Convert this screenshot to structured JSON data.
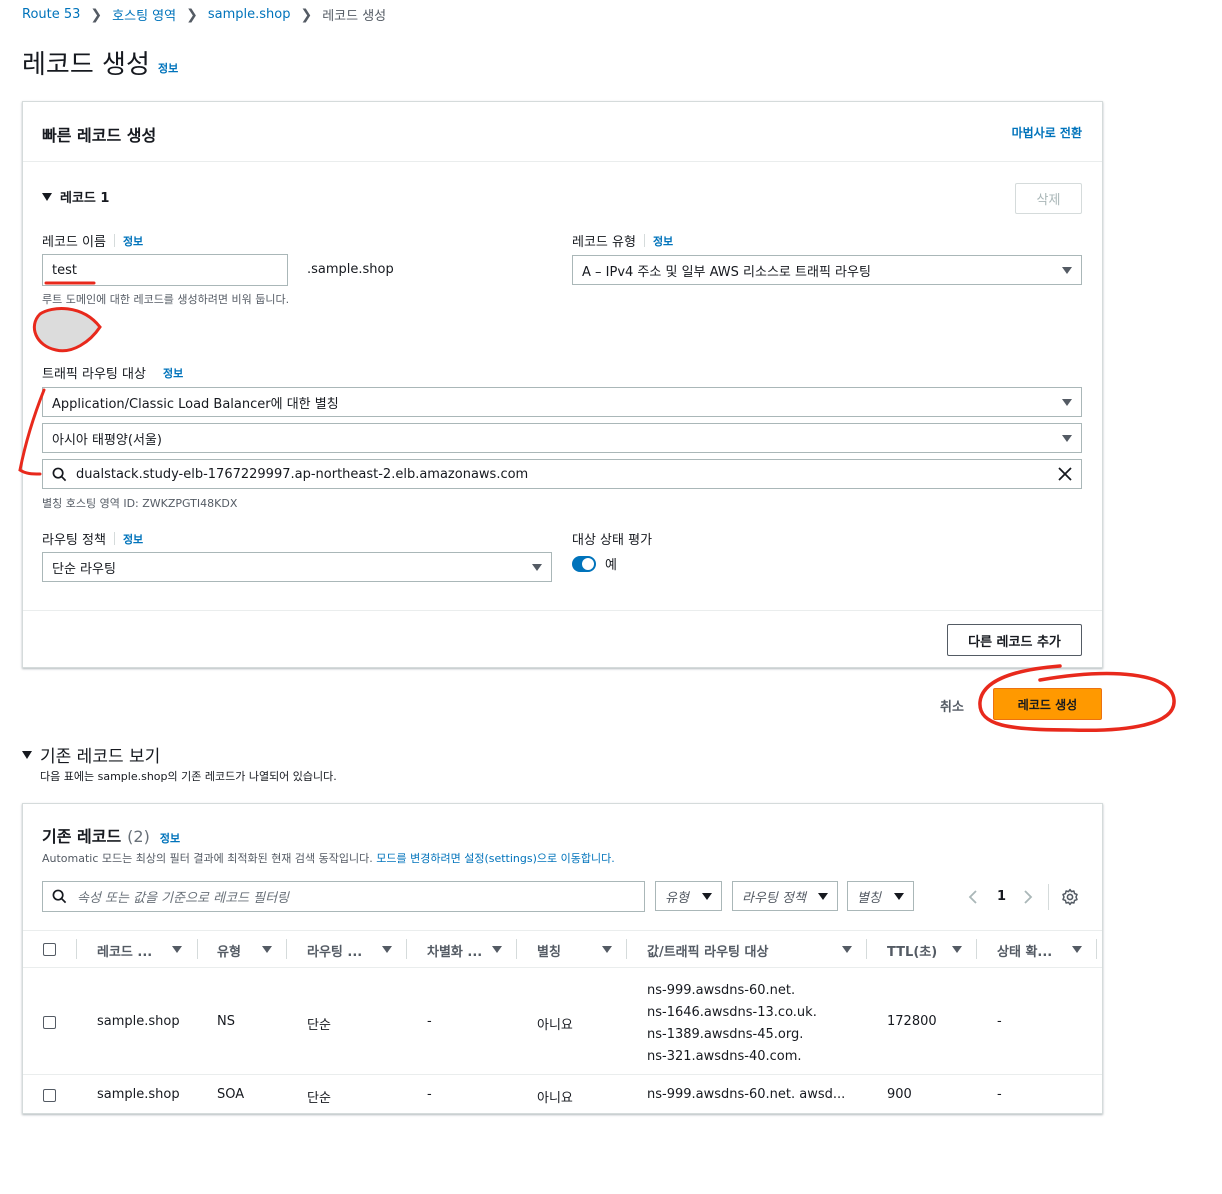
{
  "breadcrumb": {
    "items": [
      "Route 53",
      "호스팅 영역",
      "sample.shop"
    ],
    "current": "레코드 생성"
  },
  "page": {
    "title": "레코드 생성",
    "info": "정보"
  },
  "quick_create": {
    "title": "빠른 레코드 생성",
    "wizard_link": "마법사로 전환",
    "record_section": "레코드 1",
    "delete_button": "삭제",
    "record_name_label": "레코드 이름",
    "record_name_info": "정보",
    "record_name_value": "test",
    "domain_suffix": ".sample.shop",
    "record_name_hint": "루트 도메인에 대한 레코드를 생성하려면 비워 둡니다.",
    "record_type_label": "레코드 유형",
    "record_type_info": "정보",
    "record_type_value": "A – IPv4 주소 및 일부 AWS 리소스로 트래픽 라우팅",
    "traffic_target_label": "트래픽 라우팅 대상",
    "traffic_target_info": "정보",
    "alias_target_value": "Application/Classic Load Balancer에 대한 별칭",
    "region_value": "아시아 태평양(서울)",
    "endpoint_value": "dualstack.study-elb-1767229997.ap-northeast-2.elb.amazonaws.com",
    "alias_zone_hint": "별칭 호스팅 영역 ID: ZWKZPGTI48KDX",
    "routing_policy_label": "라우팅 정책",
    "routing_policy_info": "정보",
    "routing_policy_value": "단순 라우팅",
    "health_label": "대상 상태 평가",
    "health_value": "예",
    "add_record_button": "다른 레코드 추가"
  },
  "actions": {
    "cancel": "취소",
    "create": "레코드 생성"
  },
  "existing": {
    "toggle_title": "기존 레코드 보기",
    "toggle_desc": "다음 표에는 sample.shop의 기존 레코드가 나열되어 있습니다.",
    "table_title": "기존 레코드",
    "count": "(2)",
    "info": "정보",
    "desc_prefix": "Automatic 모드는 최상의 필터 결과에 최적화된 현재 검색 동작입니다.",
    "desc_link": "모드를 변경하려면 설정(settings)으로 이동합니다.",
    "filter_placeholder": "속성 또는 값을 기준으로 레코드 필터링",
    "filter_type": "유형",
    "filter_routing": "라우팅 정책",
    "filter_alias": "별칭",
    "page_number": "1",
    "columns": [
      "레코드 ...",
      "유형",
      "라우팅 ...",
      "차별화 ...",
      "별칭",
      "값/트래픽 라우팅 대상",
      "TTL(초)",
      "상태 확..."
    ],
    "rows": [
      {
        "name": "sample.shop",
        "type": "NS",
        "routing": "단순",
        "diff": "-",
        "alias": "아니요",
        "values": [
          "ns-999.awsdns-60.net.",
          "ns-1646.awsdns-13.co.uk.",
          "ns-1389.awsdns-45.org.",
          "ns-321.awsdns-40.com."
        ],
        "ttl": "172800",
        "health": "-"
      },
      {
        "name": "sample.shop",
        "type": "SOA",
        "routing": "단순",
        "diff": "-",
        "alias": "아니요",
        "values": [
          "ns-999.awsdns-60.net. awsd..."
        ],
        "ttl": "900",
        "health": "-"
      }
    ]
  },
  "colors": {
    "link": "#0073bb",
    "primary": "#ff9900",
    "annotation": "#e8291c"
  }
}
